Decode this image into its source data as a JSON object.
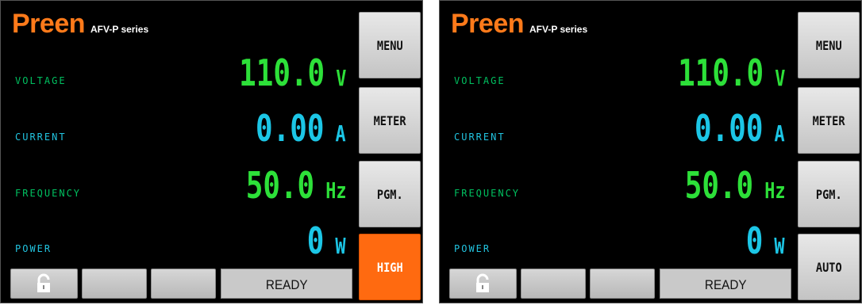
{
  "brand": {
    "name": "Preen",
    "series": "AFV-P series"
  },
  "labels": {
    "voltage": "VOLTAGE",
    "current": "CURRENT",
    "frequency": "FREQUENCY",
    "power": "POWER"
  },
  "readings": {
    "voltage": {
      "value": "110.0",
      "unit": "V"
    },
    "current": {
      "value": "0.00",
      "unit": "A"
    },
    "frequency": {
      "value": "50.0",
      "unit": "Hz"
    },
    "power": {
      "value": "0",
      "unit": "W"
    }
  },
  "screens": [
    {
      "side_buttons": [
        "MENU",
        "METER",
        "PGM.",
        "HIGH"
      ],
      "active_mode_color": "#ff6a10",
      "status": "READY",
      "icons": {
        "lock": "unlocked-padlock-icon"
      }
    },
    {
      "side_buttons": [
        "MENU",
        "METER",
        "PGM.",
        "AUTO"
      ],
      "status": "READY",
      "icons": {
        "lock": "unlocked-padlock-icon"
      }
    }
  ],
  "colors": {
    "brand": "#ff7a1a",
    "green": "#2de039",
    "cyan": "#1cc6e6",
    "background": "#000000"
  }
}
